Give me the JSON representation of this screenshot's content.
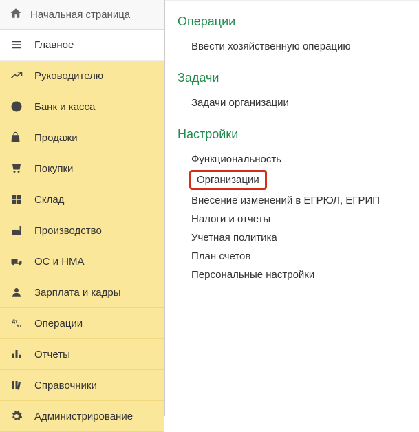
{
  "home": {
    "label": "Начальная страница"
  },
  "nav": {
    "main": {
      "label": "Главное"
    },
    "items": [
      {
        "label": "Руководителю"
      },
      {
        "label": "Банк и касса"
      },
      {
        "label": "Продажи"
      },
      {
        "label": "Покупки"
      },
      {
        "label": "Склад"
      },
      {
        "label": "Производство"
      },
      {
        "label": "ОС и НМА"
      },
      {
        "label": "Зарплата и кадры"
      },
      {
        "label": "Операции"
      },
      {
        "label": "Отчеты"
      },
      {
        "label": "Справочники"
      },
      {
        "label": "Администрирование"
      }
    ]
  },
  "content": {
    "sections": [
      {
        "title": "Операции",
        "links": [
          {
            "label": "Ввести хозяйственную операцию",
            "highlight": false
          }
        ]
      },
      {
        "title": "Задачи",
        "links": [
          {
            "label": "Задачи организации",
            "highlight": false
          }
        ]
      },
      {
        "title": "Настройки",
        "links": [
          {
            "label": "Функциональность",
            "highlight": false
          },
          {
            "label": "Организации",
            "highlight": true
          },
          {
            "label": "Внесение изменений в ЕГРЮЛ, ЕГРИП",
            "highlight": false
          },
          {
            "label": "Налоги и отчеты",
            "highlight": false
          },
          {
            "label": "Учетная политика",
            "highlight": false
          },
          {
            "label": "План счетов",
            "highlight": false
          },
          {
            "label": "Персональные настройки",
            "highlight": false
          }
        ]
      }
    ]
  }
}
